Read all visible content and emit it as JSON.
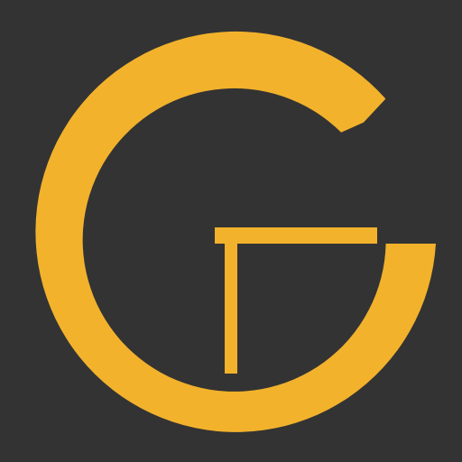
{
  "icon": {
    "name": "g-table-logo-icon",
    "colors": {
      "background": "#333333",
      "accent": "#F2B22C"
    }
  }
}
